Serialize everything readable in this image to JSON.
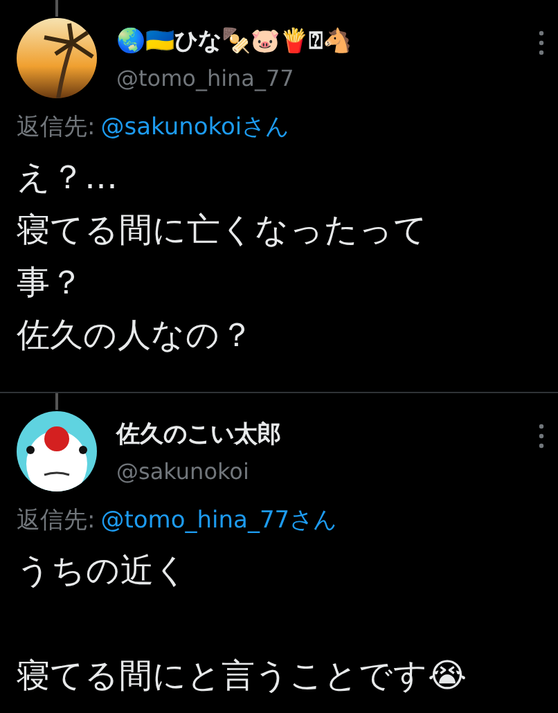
{
  "tweets": [
    {
      "kind": "sunset",
      "display_name": "🌏🇺🇦ひな🍢🐷🍟⍰🐴",
      "handle": "@tomo_hina_77",
      "reply_label": "返信先:",
      "reply_to": "@sakunokoiさん",
      "paragraphs": [
        [
          "え？…",
          "寝てる間に亡くなったって",
          "事？",
          "佐久の人なの？"
        ]
      ]
    },
    {
      "kind": "mascot",
      "display_name": "佐久のこい太郎",
      "handle": "@sakunokoi",
      "reply_label": "返信先:",
      "reply_to": "@tomo_hina_77さん",
      "paragraphs": [
        [
          "うちの近く"
        ],
        [
          "寝てる間にと言うことです😭"
        ]
      ]
    }
  ]
}
